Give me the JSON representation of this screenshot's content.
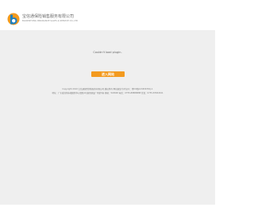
{
  "header": {
    "company_name_cn": "宝信通保险销售服务有限公司",
    "company_name_en": "BAOXINTONG INSURANCE SALES & SERVICE CO.,LTD"
  },
  "main": {
    "notice": "Couldn't load plugin.",
    "enter_button": "进入网站"
  },
  "footer": {
    "copyright": "Copyright 2019 宝信通保险销售服务有限公司 版权所有 网站备案/许可证号：粤ICP备12345678号-1",
    "address": "地址：广东省深圳市福田区中心四路1号嘉里建设广场第3座 邮编：518048 电话：0755-88888888 传真：0755-87654321"
  },
  "colors": {
    "accent": "#f39a1f",
    "background": "#efefef",
    "logo_orange": "#f39a1f",
    "logo_blue": "#1d7fbf"
  }
}
